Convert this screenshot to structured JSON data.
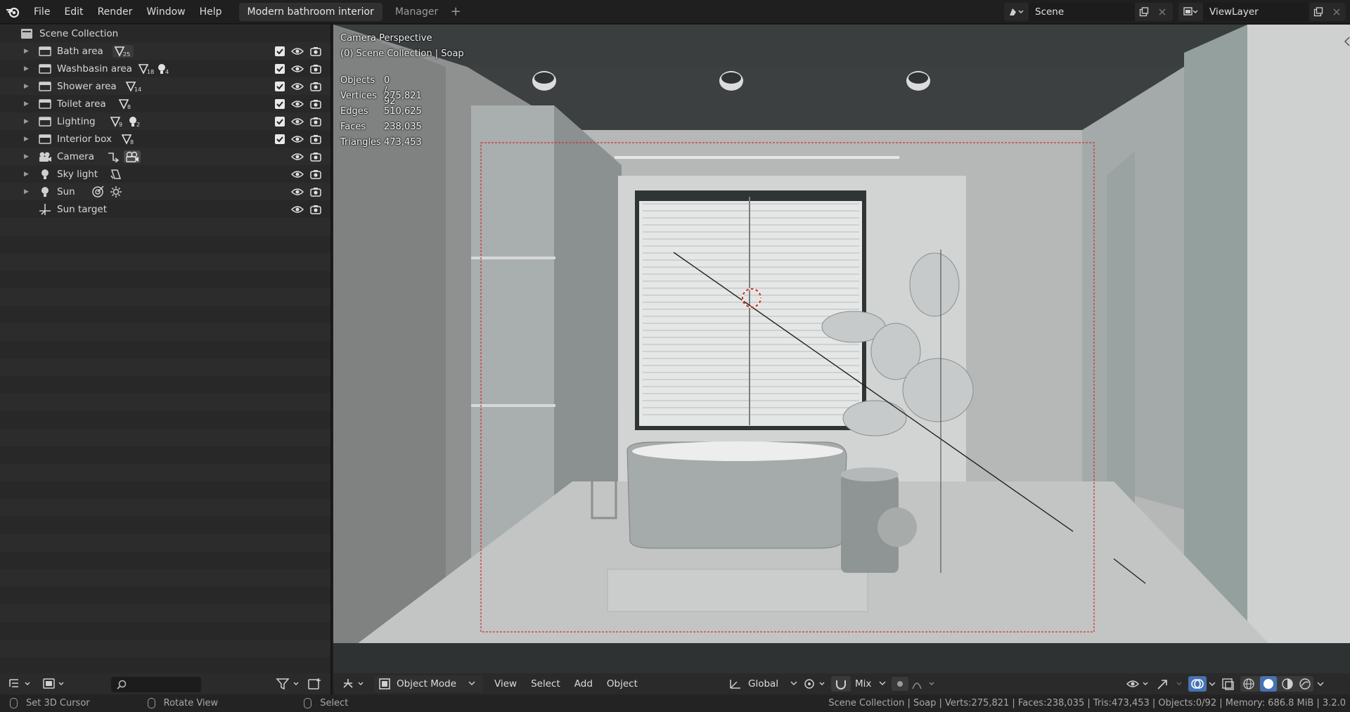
{
  "menu": {
    "items": [
      "File",
      "Edit",
      "Render",
      "Window",
      "Help"
    ]
  },
  "workspaces": {
    "active": "Modern bathroom interior",
    "other": "Manager",
    "add": "+"
  },
  "scene": {
    "name": "Scene"
  },
  "view_layer": {
    "name": "ViewLayer"
  },
  "outliner": {
    "root": "Scene Collection",
    "rows": [
      {
        "label": "Bath area",
        "badges": [
          "25"
        ]
      },
      {
        "label": "Washbasin area",
        "badges": [
          "18",
          "4"
        ]
      },
      {
        "label": "Shower area",
        "badges": [
          "14"
        ]
      },
      {
        "label": "Toilet area",
        "badges": [
          "8"
        ]
      },
      {
        "label": "Lighting",
        "badges": [
          "9",
          "2"
        ]
      },
      {
        "label": "Interior box",
        "badges": [
          "8"
        ]
      },
      {
        "label": "Camera"
      },
      {
        "label": "Sky light"
      },
      {
        "label": "Sun"
      },
      {
        "label": "Sun target"
      }
    ],
    "search_placeholder": ""
  },
  "viewport": {
    "mode_label": "Camera Perspective",
    "context_label": "(0) Scene Collection | Soap",
    "stats": [
      {
        "label": "Objects",
        "value": "0 / 92"
      },
      {
        "label": "Vertices",
        "value": "275,821"
      },
      {
        "label": "Edges",
        "value": "510,625"
      },
      {
        "label": "Faces",
        "value": "238,035"
      },
      {
        "label": "Triangles",
        "value": "473,453"
      }
    ],
    "header": {
      "mode": "Object Mode",
      "menus": [
        "View",
        "Select",
        "Add",
        "Object"
      ],
      "orientation": "Global",
      "snap_mode": "Mix"
    }
  },
  "statusbar": {
    "hints": [
      "Set 3D Cursor",
      "Rotate View",
      "Select"
    ],
    "info": "Scene Collection | Soap | Verts:275,821 | Faces:238,035 | Tris:473,453 | Objects:0/92 | Memory: 686.8 MiB | 3.2.0"
  },
  "colors": {
    "accent_blue": "#4772b3",
    "checkbox": "#e8e8e8",
    "camera_frame": "#d03030"
  }
}
